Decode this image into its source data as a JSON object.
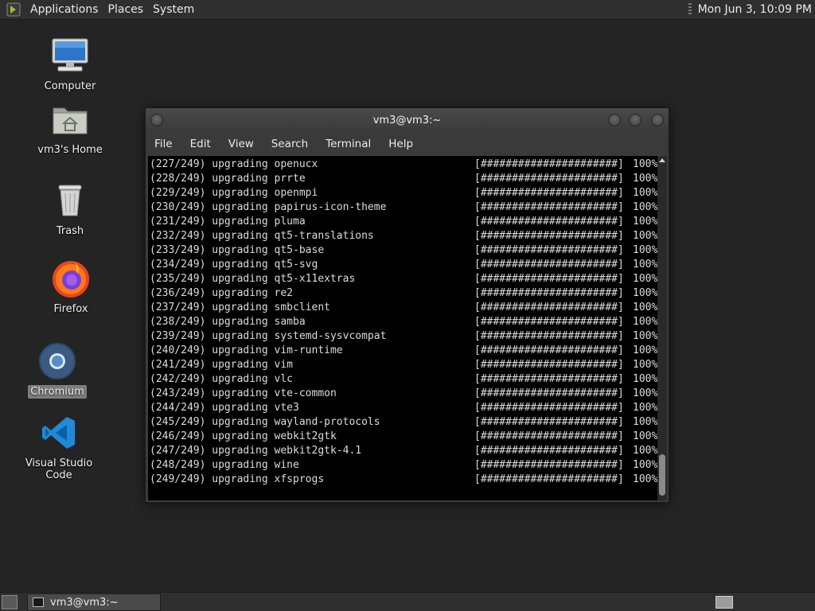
{
  "top_panel": {
    "menus": [
      "Applications",
      "Places",
      "System"
    ],
    "clock": "Mon Jun  3, 10:09 PM"
  },
  "desktop_icons": [
    {
      "label": "Computer",
      "icon": "computer-icon"
    },
    {
      "label": "vm3's Home",
      "icon": "home-folder-icon"
    },
    {
      "label": "Trash",
      "icon": "trash-icon"
    },
    {
      "label": "Firefox",
      "icon": "firefox-icon"
    },
    {
      "label": "Chromium",
      "icon": "chromium-icon",
      "selected": true
    },
    {
      "label": "Visual Studio Code",
      "icon": "vscode-icon"
    }
  ],
  "window": {
    "title": "vm3@vm3:~",
    "menu": [
      "File",
      "Edit",
      "View",
      "Search",
      "Terminal",
      "Help"
    ]
  },
  "terminal": {
    "progress_bar": "[######################]",
    "percent": "100%",
    "lines": [
      "(227/249) upgrading openucx",
      "(228/249) upgrading prrte",
      "(229/249) upgrading openmpi",
      "(230/249) upgrading papirus-icon-theme",
      "(231/249) upgrading pluma",
      "(232/249) upgrading qt5-translations",
      "(233/249) upgrading qt5-base",
      "(234/249) upgrading qt5-svg",
      "(235/249) upgrading qt5-x11extras",
      "(236/249) upgrading re2",
      "(237/249) upgrading smbclient",
      "(238/249) upgrading samba",
      "(239/249) upgrading systemd-sysvcompat",
      "(240/249) upgrading vim-runtime",
      "(241/249) upgrading vim",
      "(242/249) upgrading vlc",
      "(243/249) upgrading vte-common",
      "(244/249) upgrading vte3",
      "(245/249) upgrading wayland-protocols",
      "(246/249) upgrading webkit2gtk",
      "(247/249) upgrading webkit2gtk-4.1",
      "(248/249) upgrading wine",
      "(249/249) upgrading xfsprogs"
    ]
  },
  "taskbar": {
    "task_label": "vm3@vm3:~"
  },
  "colors": {
    "desktop_bg": "#242424",
    "panel_bg": "#2f2f2f",
    "terminal_bg": "#000000",
    "terminal_fg": "#dcdcdc"
  }
}
